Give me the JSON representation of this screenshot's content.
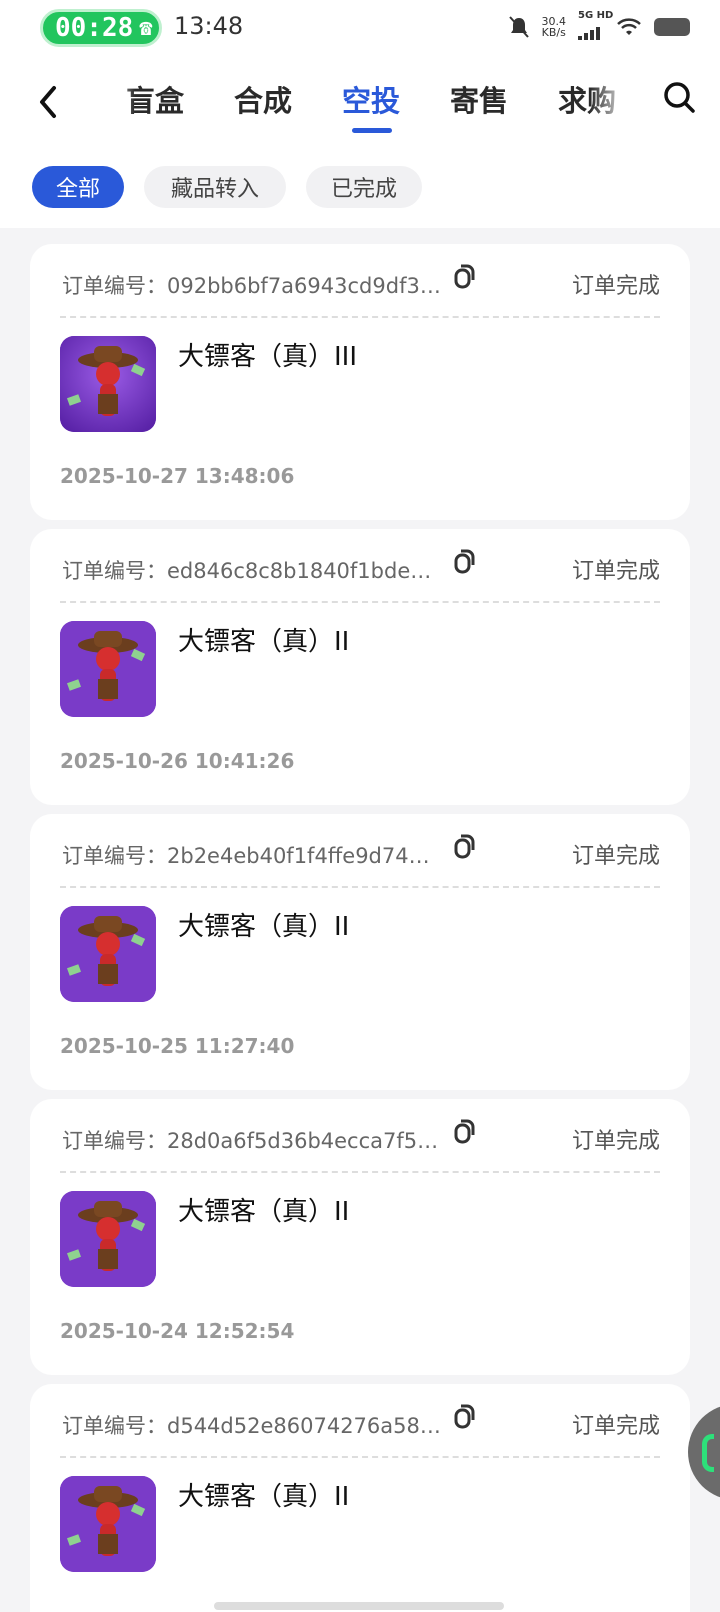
{
  "status_bar": {
    "call_time": "00:28",
    "clock": "13:48",
    "net_speed_value": "30.4",
    "net_speed_unit": "KB/s",
    "network": "5G HD"
  },
  "nav": {
    "tabs": [
      {
        "label": "盲盒",
        "active": false
      },
      {
        "label": "合成",
        "active": false
      },
      {
        "label": "空投",
        "active": true
      },
      {
        "label": "寄售",
        "active": false
      },
      {
        "label": "求购",
        "active": false
      }
    ]
  },
  "filters": [
    {
      "label": "全部",
      "active": true
    },
    {
      "label": "藏品转入",
      "active": false
    },
    {
      "label": "已完成",
      "active": false
    }
  ],
  "orders": [
    {
      "order_label": "订单编号：092bb6bf7a6943cd9df33...",
      "status": "订单完成",
      "product": "大镖客（真）III",
      "time": "2025-10-27 13:48:06"
    },
    {
      "order_label": "订单编号：ed846c8c8b1840f1bdec4...",
      "status": "订单完成",
      "product": "大镖客（真）II",
      "time": "2025-10-26 10:41:26"
    },
    {
      "order_label": "订单编号：2b2e4eb40f1f4ffe9d7428...",
      "status": "订单完成",
      "product": "大镖客（真）II",
      "time": "2025-10-25 11:27:40"
    },
    {
      "order_label": "订单编号：28d0a6f5d36b4ecca7f5b...",
      "status": "订单完成",
      "product": "大镖客（真）II",
      "time": "2025-10-24 12:52:54"
    },
    {
      "order_label": "订单编号：d544d52e86074276a5874...",
      "status": "订单完成",
      "product": "大镖客（真）II",
      "time": ""
    }
  ],
  "colors": {
    "accent": "#2a59d9",
    "call": "#22c55e"
  }
}
